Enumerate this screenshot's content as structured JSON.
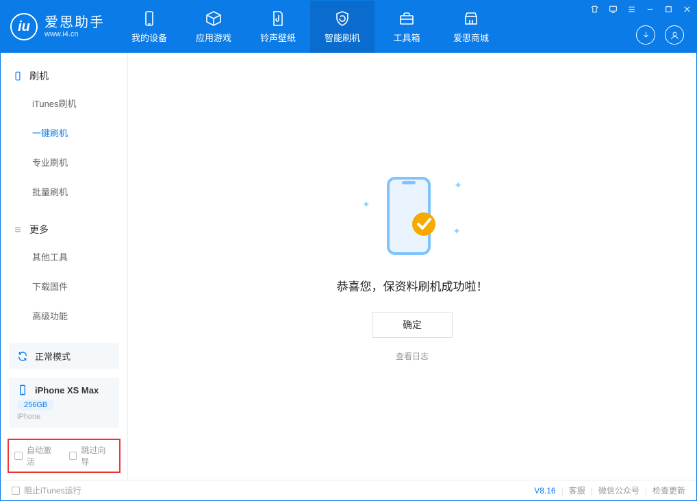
{
  "app": {
    "name_cn": "爱思助手",
    "name_en": "www.i4.cn"
  },
  "nav": {
    "items": [
      {
        "label": "我的设备"
      },
      {
        "label": "应用游戏"
      },
      {
        "label": "铃声壁纸"
      },
      {
        "label": "智能刷机"
      },
      {
        "label": "工具箱"
      },
      {
        "label": "爱思商城"
      }
    ]
  },
  "sidebar": {
    "section1": {
      "title": "刷机",
      "items": [
        "iTunes刷机",
        "一键刷机",
        "专业刷机",
        "批量刷机"
      ],
      "active_index": 1
    },
    "section2": {
      "title": "更多",
      "items": [
        "其他工具",
        "下载固件",
        "高级功能"
      ]
    },
    "mode": "正常模式",
    "device": {
      "name": "iPhone XS Max",
      "capacity": "256GB",
      "type": "iPhone"
    },
    "options": {
      "auto_activate": "自动激活",
      "skip_guide": "跳过向导"
    }
  },
  "main": {
    "success_msg": "恭喜您，保资料刷机成功啦！",
    "ok_label": "确定",
    "log_link": "查看日志"
  },
  "status": {
    "block_itunes": "阻止iTunes运行",
    "version": "V8.16",
    "links": [
      "客服",
      "微信公众号",
      "检查更新"
    ]
  }
}
